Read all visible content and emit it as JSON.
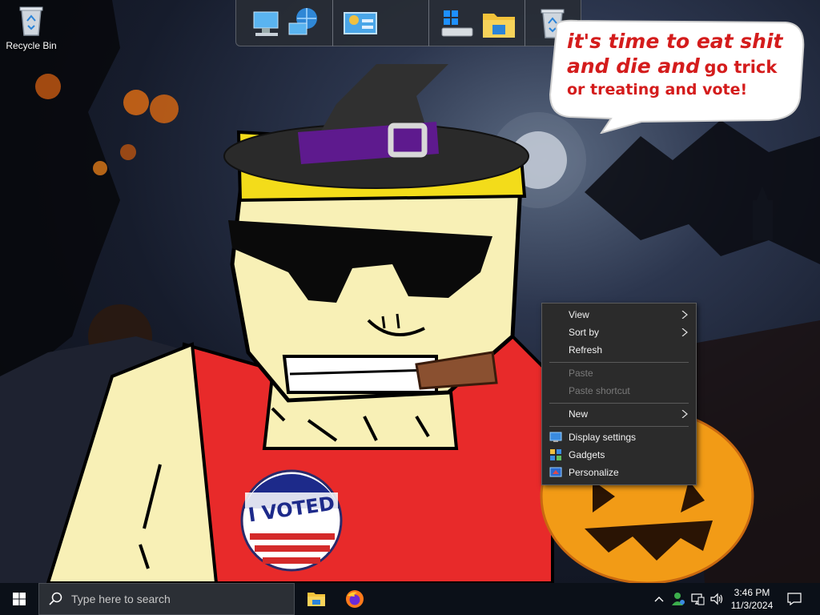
{
  "desktop": {
    "icons": [
      {
        "label": "Recycle Bin",
        "icon": "recycle-bin-icon"
      }
    ]
  },
  "dock": {
    "items": [
      "network-computers-icon",
      "control-panel-icon",
      "windows-this-pc-icon",
      "file-explorer-icon",
      "recycle-bin-icon"
    ]
  },
  "wallpaper": {
    "speech_line1": "it's time to eat shit",
    "speech_line2a": "and die and",
    "speech_line2b": "go trick",
    "speech_line3": "or treating and vote!",
    "sticker": "I VOTED"
  },
  "context_menu": {
    "items": [
      {
        "label": "View",
        "submenu": true,
        "enabled": true
      },
      {
        "label": "Sort by",
        "submenu": true,
        "enabled": true
      },
      {
        "label": "Refresh",
        "submenu": false,
        "enabled": true
      },
      {
        "label": "Paste",
        "submenu": false,
        "enabled": false
      },
      {
        "label": "Paste shortcut",
        "submenu": false,
        "enabled": false
      },
      {
        "label": "New",
        "submenu": true,
        "enabled": true
      },
      {
        "label": "Display settings",
        "submenu": false,
        "enabled": true,
        "icon": "display-settings-icon"
      },
      {
        "label": "Gadgets",
        "submenu": false,
        "enabled": true,
        "icon": "gadgets-icon"
      },
      {
        "label": "Personalize",
        "submenu": false,
        "enabled": true,
        "icon": "personalize-icon"
      }
    ]
  },
  "taskbar": {
    "search_placeholder": "Type here to search",
    "apps": [
      "file-explorer-icon",
      "firefox-icon"
    ],
    "tray": [
      "show-hidden-icons-chevron",
      "people-icon",
      "network-icon",
      "volume-icon"
    ],
    "time": "3:46 PM",
    "date": "11/3/2024"
  },
  "colors": {
    "taskbar": "#0b1018",
    "menu_bg": "#2b2b2b",
    "speech_text": "#d41c1c",
    "shirt": "#e82a2a",
    "skin": "#f8f0b6"
  }
}
